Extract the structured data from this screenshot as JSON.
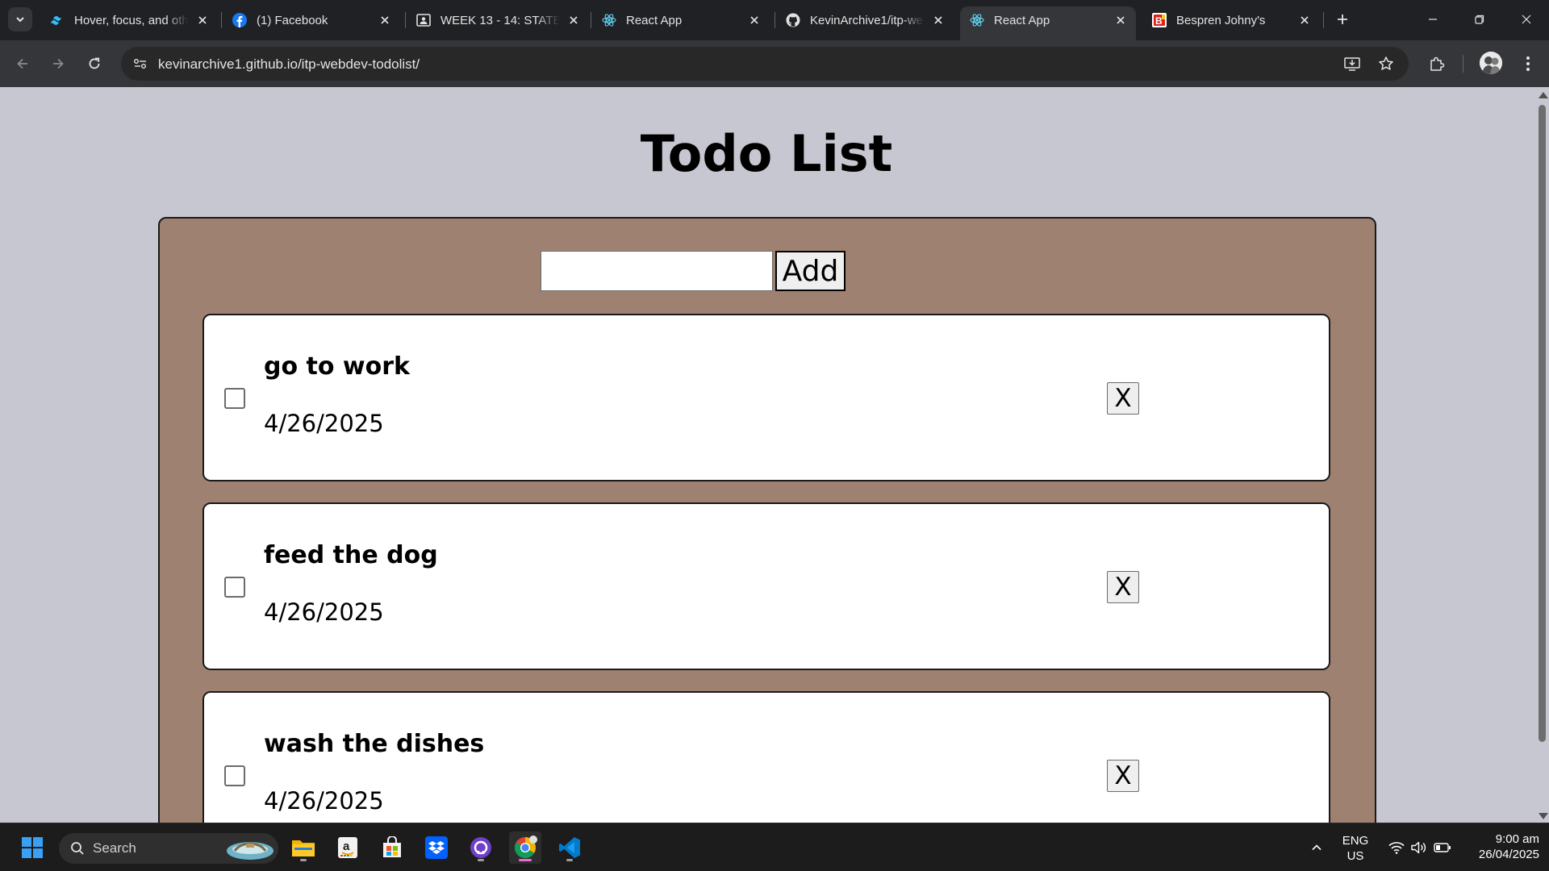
{
  "browser": {
    "tabs": [
      {
        "title": "Hover, focus, and oth",
        "icon": "tailwind-icon",
        "active": false
      },
      {
        "title": "(1) Facebook",
        "icon": "facebook-icon",
        "active": false
      },
      {
        "title": "WEEK 13 - 14: STATE",
        "icon": "classroom-icon",
        "active": false
      },
      {
        "title": "React App",
        "icon": "react-icon",
        "active": false
      },
      {
        "title": "KevinArchive1/itp-we",
        "icon": "github-icon",
        "active": false
      },
      {
        "title": "React App",
        "icon": "react-icon",
        "active": true
      },
      {
        "title": "Bespren Johny's",
        "icon": "blogger-icon",
        "active": false
      }
    ],
    "url": "kevinarchive1.github.io/itp-webdev-todolist/"
  },
  "app": {
    "title": "Todo List",
    "input": {
      "value": "",
      "placeholder": ""
    },
    "add_label": "Add",
    "todos": [
      {
        "text": "go to work",
        "date": "4/26/2025",
        "done": false,
        "delete_label": "X"
      },
      {
        "text": "feed the dog",
        "date": "4/26/2025",
        "done": false,
        "delete_label": "X"
      },
      {
        "text": "wash the dishes",
        "date": "4/26/2025",
        "done": false,
        "delete_label": "X"
      }
    ],
    "colors": {
      "page_bg": "#c7c7d1",
      "board_bg": "#9e8171",
      "card_bg": "#ffffff"
    }
  },
  "taskbar": {
    "search_label": "Search",
    "apps": [
      "file-explorer-icon",
      "amazon-icon",
      "microsoft-store-icon",
      "dropbox-icon",
      "github-desktop-icon",
      "chrome-icon",
      "vscode-icon"
    ],
    "language": {
      "line1": "ENG",
      "line2": "US"
    },
    "time": "9:00 am",
    "date": "26/04/2025"
  }
}
